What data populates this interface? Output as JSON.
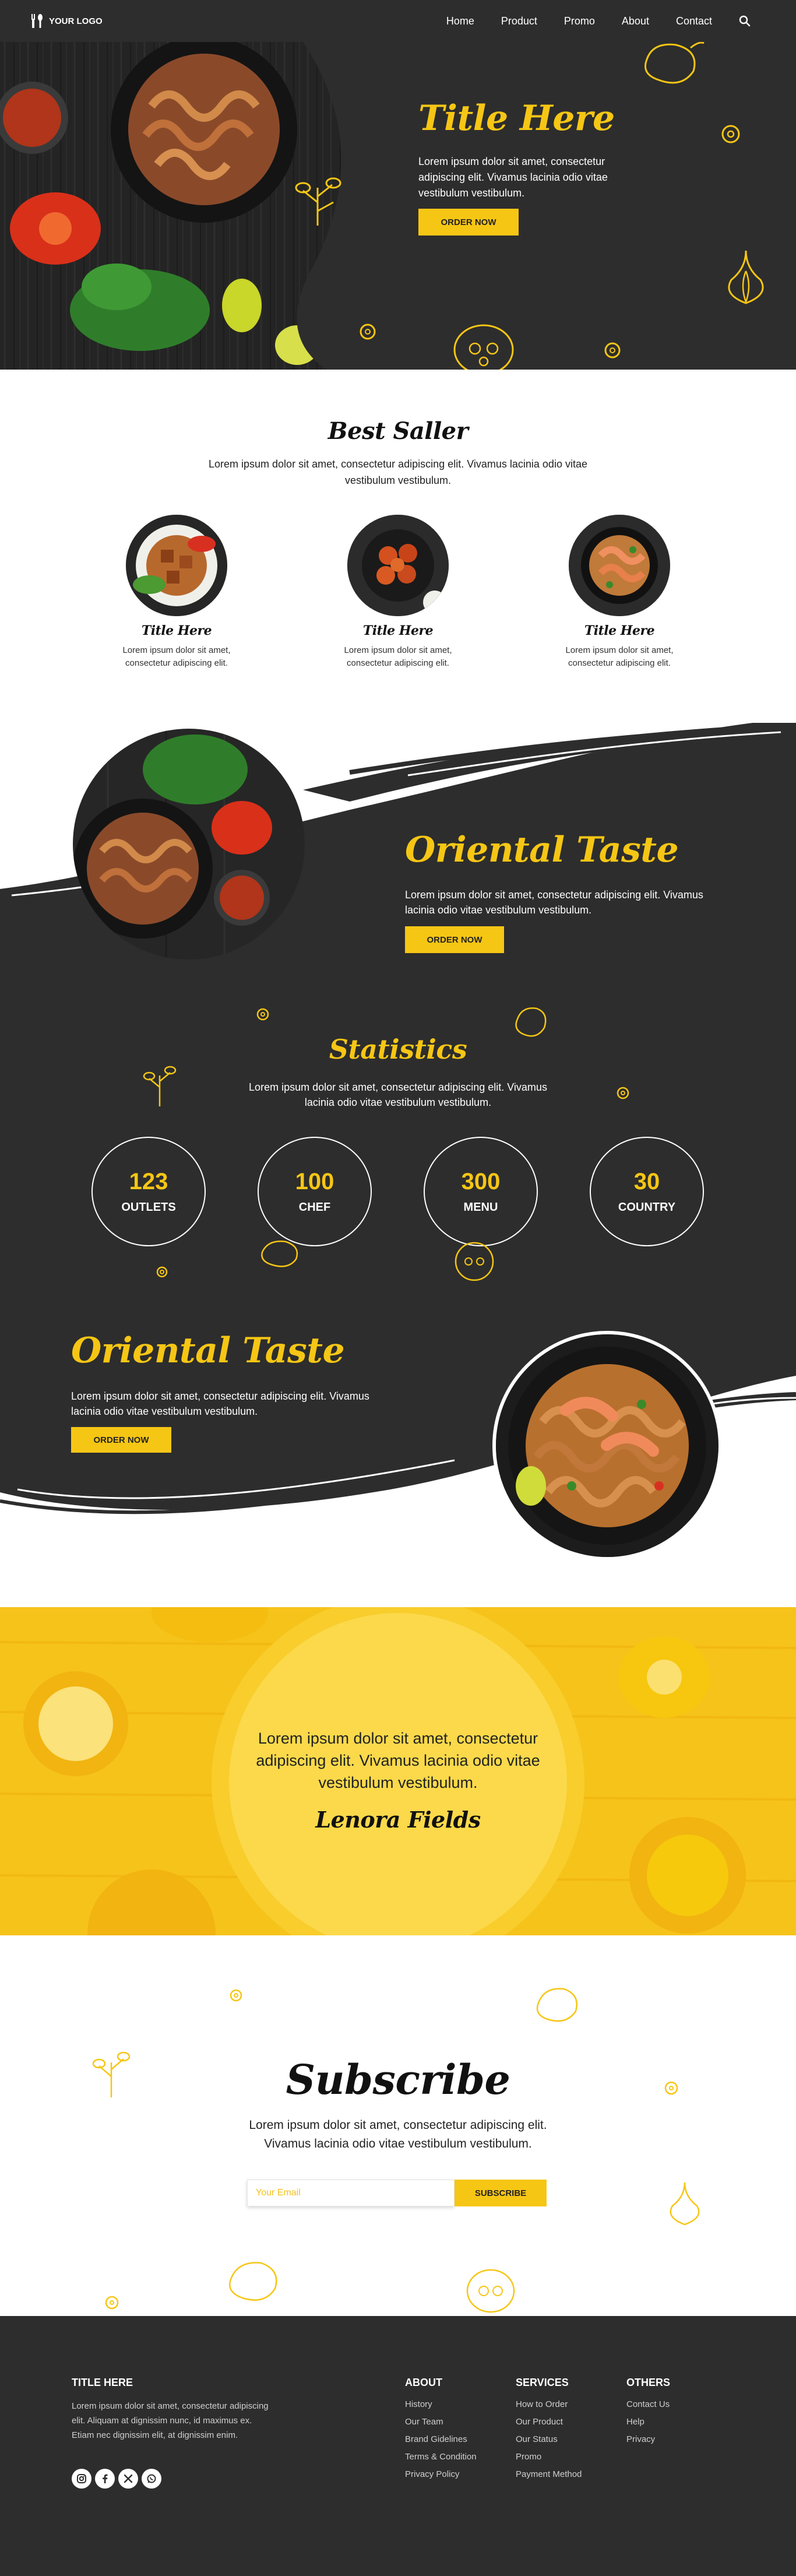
{
  "nav": {
    "logo_text": "YOUR LOGO",
    "links": [
      "Home",
      "Product",
      "Promo",
      "About",
      "Contact"
    ]
  },
  "hero": {
    "title": "Title Here",
    "text": "Lorem ipsum dolor sit amet, consectetur adipiscing elit. Vivamus lacinia odio vitae vestibulum vestibulum.",
    "button": "ORDER NOW"
  },
  "best_seller": {
    "title": "Best Saller",
    "subtitle": "Lorem ipsum dolor sit amet, consectetur adipiscing elit. Vivamus lacinia odio vitae vestibulum vestibulum.",
    "items": [
      {
        "name": "Title Here",
        "desc": "Lorem ipsum dolor sit amet, consectetur adipiscing elit."
      },
      {
        "name": "Title Here",
        "desc": "Lorem ipsum dolor sit amet, consectetur adipiscing elit."
      },
      {
        "name": "Title Here",
        "desc": "Lorem ipsum dolor sit amet, consectetur adipiscing elit."
      }
    ]
  },
  "oriental_1": {
    "title": "Oriental Taste",
    "text": "Lorem ipsum dolor sit amet, consectetur adipiscing elit. Vivamus lacinia odio vitae vestibulum vestibulum.",
    "button": "ORDER NOW"
  },
  "statistics": {
    "title": "Statistics",
    "subtitle": "Lorem ipsum dolor sit amet, consectetur adipiscing elit. Vivamus lacinia odio vitae vestibulum vestibulum.",
    "items": [
      {
        "value": "123",
        "label": "OUTLETS"
      },
      {
        "value": "100",
        "label": "CHEF"
      },
      {
        "value": "300",
        "label": "MENU"
      },
      {
        "value": "30",
        "label": "COUNTRY"
      }
    ]
  },
  "oriental_2": {
    "title": "Oriental Taste",
    "text": "Lorem ipsum dolor sit amet, consectetur adipiscing elit. Vivamus lacinia odio vitae vestibulum vestibulum.",
    "button": "ORDER NOW"
  },
  "testimonial": {
    "quote": "Lorem ipsum dolor sit amet, consectetur adipiscing elit. Vivamus lacinia odio vitae vestibulum vestibulum.",
    "name": "Lenora Fields"
  },
  "subscribe": {
    "title": "Subscribe",
    "text": "Lorem ipsum dolor sit amet, consectetur adipiscing elit. Vivamus lacinia odio vitae vestibulum vestibulum.",
    "placeholder": "Your Email",
    "button": "SUBSCRIBE"
  },
  "footer": {
    "title": "TITLE HERE",
    "text": "Lorem ipsum dolor sit amet, consectetur adipiscing elit. Aliquam at dignissim nunc, id maximus ex. Etiam nec dignissim elit, at dignissim enim.",
    "social_icons": [
      "instagram-icon",
      "facebook-icon",
      "x-icon",
      "whatsapp-icon"
    ],
    "columns": [
      {
        "title": "ABOUT",
        "links": [
          "History",
          "Our Team",
          "Brand Gidelines",
          "Terms & Condition",
          "Privacy Policy"
        ]
      },
      {
        "title": "SERVICES",
        "links": [
          "How to Order",
          "Our Product",
          "Our Status",
          "Promo",
          "Payment Method"
        ]
      },
      {
        "title": "OTHERS",
        "links": [
          "Contact Us",
          "Help",
          "Privacy"
        ]
      }
    ]
  },
  "colors": {
    "accent": "#f6c615",
    "dark": "#2d2d2d",
    "white": "#ffffff"
  }
}
